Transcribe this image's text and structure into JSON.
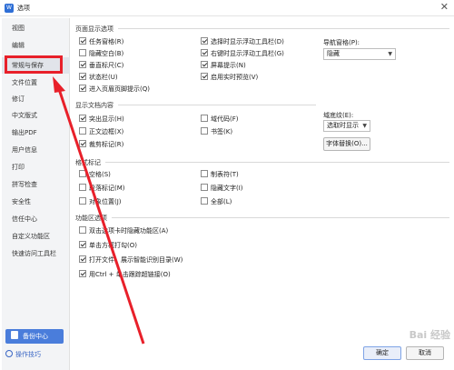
{
  "window": {
    "title": "选项",
    "app_icon_text": "W",
    "close_glyph": "✕"
  },
  "sidebar": {
    "items": [
      {
        "label": "视图"
      },
      {
        "label": "编辑"
      },
      {
        "label": "常规与保存"
      },
      {
        "label": "文件位置"
      },
      {
        "label": "修订"
      },
      {
        "label": "中文版式"
      },
      {
        "label": "输出PDF"
      },
      {
        "label": "用户信息"
      },
      {
        "label": "打印"
      },
      {
        "label": "拼写检查"
      },
      {
        "label": "安全性"
      },
      {
        "label": "信任中心"
      },
      {
        "label": "自定义功能区"
      },
      {
        "label": "快速访问工具栏"
      }
    ],
    "backup_label": "备份中心",
    "tips_label": "操作技巧"
  },
  "page_display": {
    "title": "页面显示选项",
    "col1": [
      {
        "label": "任务窗格(R)",
        "checked": true
      },
      {
        "label": "隐藏空白(B)",
        "checked": false
      },
      {
        "label": "垂直标尺(C)",
        "checked": true
      },
      {
        "label": "状态栏(U)",
        "checked": true
      },
      {
        "label": "进入页眉页脚提示(Q)",
        "checked": true
      }
    ],
    "col2": [
      {
        "label": "选择时显示浮动工具栏(D)",
        "checked": true
      },
      {
        "label": "右键时显示浮动工具栏(G)",
        "checked": true
      },
      {
        "label": "屏幕提示(N)",
        "checked": true
      },
      {
        "label": "启用实时预览(V)",
        "checked": true
      }
    ],
    "nav_label": "导航窗格(P):",
    "nav_value": "隐藏"
  },
  "doc_content": {
    "title": "显示文档内容",
    "col1": [
      {
        "label": "突出显示(H)",
        "checked": true
      },
      {
        "label": "正文边框(X)",
        "checked": false
      },
      {
        "label": "裁剪标记(R)",
        "checked": true
      }
    ],
    "col2": [
      {
        "label": "域代码(F)",
        "checked": false
      },
      {
        "label": "书签(K)",
        "checked": false
      }
    ],
    "field_shading_label": "域底纹(E):",
    "field_shading_value": "选取时显示",
    "font_replace_label": "字体替换(O)..."
  },
  "format_marks": {
    "title": "格式标记",
    "col1": [
      {
        "label": "空格(S)",
        "checked": false
      },
      {
        "label": "段落标记(M)",
        "checked": false
      },
      {
        "label": "对象位置(J)",
        "checked": false
      }
    ],
    "col2": [
      {
        "label": "制表符(T)",
        "checked": false
      },
      {
        "label": "隐藏文字(I)",
        "checked": false
      },
      {
        "label": "全部(L)",
        "checked": false
      }
    ]
  },
  "ribbon_options": {
    "title": "功能区选项",
    "items": [
      {
        "label": "双击选项卡时隐藏功能区(A)",
        "checked": false
      },
      {
        "label": "单击方框打勾(O)",
        "checked": true
      },
      {
        "label": "打开文件，展示智能识别目录(W)",
        "checked": true
      },
      {
        "label": "用Ctrl + 单击跟踪超链接(O)",
        "checked": true
      }
    ]
  },
  "dialog_buttons": {
    "ok": "确定",
    "cancel": "取消"
  },
  "watermark": "Bai 经验",
  "colors": {
    "highlight": "#e8202a",
    "accent": "#4a7ddb"
  }
}
